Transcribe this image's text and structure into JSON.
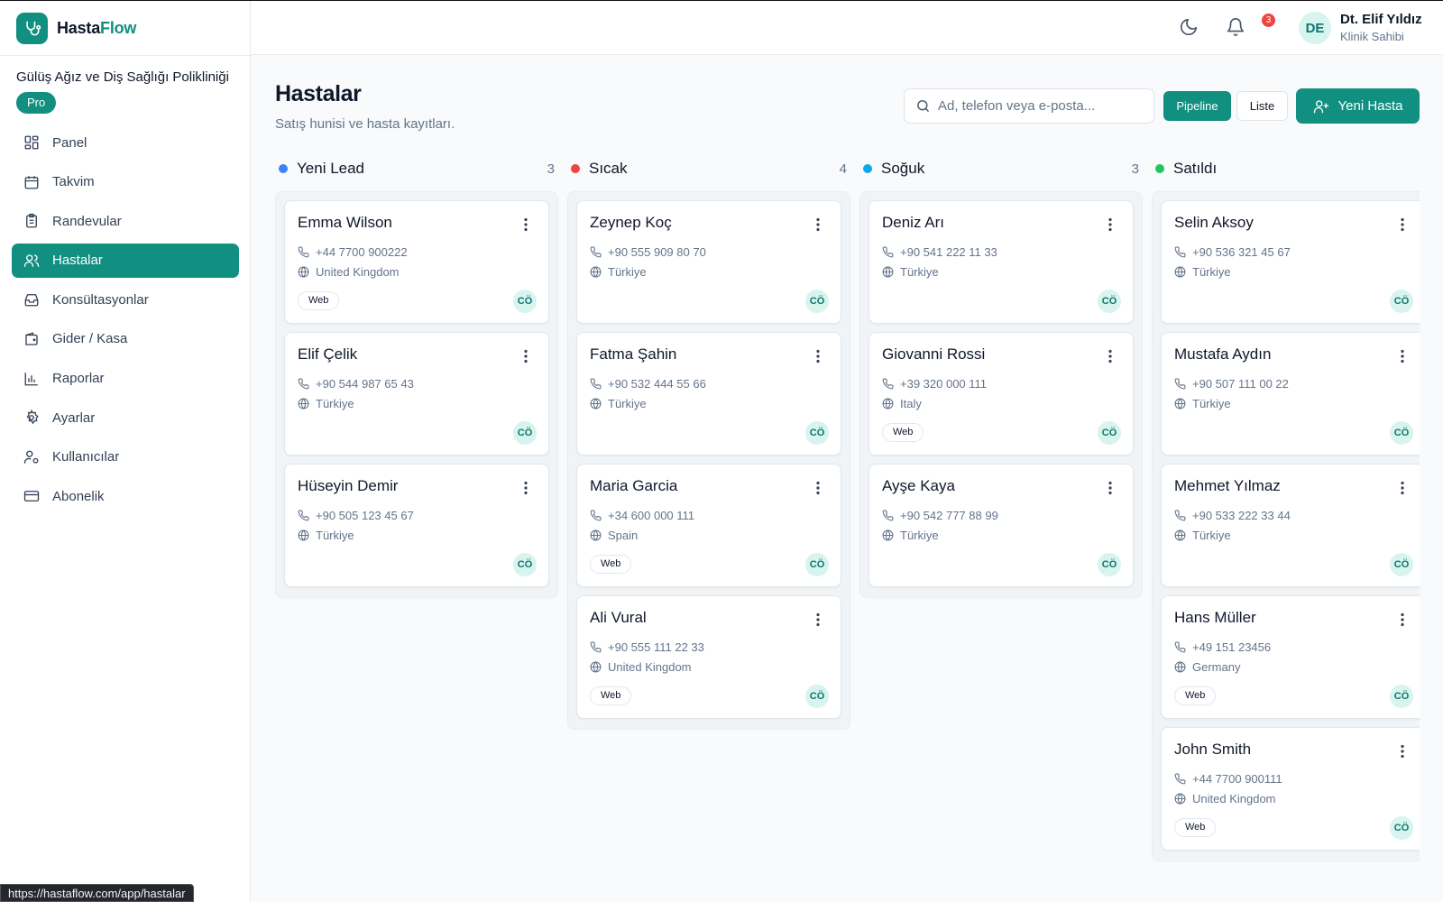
{
  "app": {
    "name_part1": "Hasta",
    "name_part2": "Flow"
  },
  "sidebar": {
    "clinic_name": "Gülüş Ağız ve Diş Sağlığı Polikliniği",
    "plan": "Pro",
    "items": [
      {
        "label": "Panel",
        "icon": "dashboard-icon"
      },
      {
        "label": "Takvim",
        "icon": "calendar-icon"
      },
      {
        "label": "Randevular",
        "icon": "clipboard-icon"
      },
      {
        "label": "Hastalar",
        "icon": "users-icon",
        "active": true
      },
      {
        "label": "Konsültasyonlar",
        "icon": "inbox-icon"
      },
      {
        "label": "Gider / Kasa",
        "icon": "wallet-icon"
      },
      {
        "label": "Raporlar",
        "icon": "bar-chart-icon"
      },
      {
        "label": "Ayarlar",
        "icon": "gear-icon"
      },
      {
        "label": "Kullanıcılar",
        "icon": "user-gear-icon"
      },
      {
        "label": "Abonelik",
        "icon": "credit-card-icon"
      }
    ]
  },
  "topbar": {
    "notification_count": "3",
    "user_initials": "DE",
    "user_name": "Dt. Elif Yıldız",
    "user_role": "Klinik Sahibi"
  },
  "page": {
    "title": "Hastalar",
    "subtitle": "Satış hunisi ve hasta kayıtları.",
    "search_placeholder": "Ad, telefon veya e-posta...",
    "pipeline_label": "Pipeline",
    "list_label": "Liste",
    "new_patient_label": "Yeni Hasta"
  },
  "status_url": "https://hastaflow.com/app/hastalar",
  "columns": [
    {
      "title": "Yeni Lead",
      "count": "3",
      "color": "#3b82f6",
      "cards": [
        {
          "name": "Emma Wilson",
          "phone": "+44 7700 900222",
          "country": "United Kingdom",
          "source": "Web",
          "assignee": "CÖ"
        },
        {
          "name": "Elif Çelik",
          "phone": "+90 544 987 65 43",
          "country": "Türkiye",
          "source": "",
          "assignee": "CÖ"
        },
        {
          "name": "Hüseyin Demir",
          "phone": "+90 505 123 45 67",
          "country": "Türkiye",
          "source": "",
          "assignee": "CÖ"
        }
      ]
    },
    {
      "title": "Sıcak",
      "count": "4",
      "color": "#ef4444",
      "cards": [
        {
          "name": "Zeynep Koç",
          "phone": "+90 555 909 80 70",
          "country": "Türkiye",
          "source": "",
          "assignee": "CÖ"
        },
        {
          "name": "Fatma Şahin",
          "phone": "+90 532 444 55 66",
          "country": "Türkiye",
          "source": "",
          "assignee": "CÖ"
        },
        {
          "name": "Maria Garcia",
          "phone": "+34 600 000 111",
          "country": "Spain",
          "source": "Web",
          "assignee": "CÖ"
        },
        {
          "name": "Ali Vural",
          "phone": "+90 555 111 22 33",
          "country": "United Kingdom",
          "source": "Web",
          "assignee": "CÖ"
        }
      ]
    },
    {
      "title": "Soğuk",
      "count": "3",
      "color": "#0ea5e9",
      "cards": [
        {
          "name": "Deniz Arı",
          "phone": "+90 541 222 11 33",
          "country": "Türkiye",
          "source": "",
          "assignee": "CÖ"
        },
        {
          "name": "Giovanni Rossi",
          "phone": "+39 320 000 111",
          "country": "Italy",
          "source": "Web",
          "assignee": "CÖ"
        },
        {
          "name": "Ayşe Kaya",
          "phone": "+90 542 777 88 99",
          "country": "Türkiye",
          "source": "",
          "assignee": "CÖ"
        }
      ]
    },
    {
      "title": "Satıldı",
      "count": "",
      "color": "#22c55e",
      "cards": [
        {
          "name": "Selin Aksoy",
          "phone": "+90 536 321 45 67",
          "country": "Türkiye",
          "source": "",
          "assignee": "CÖ"
        },
        {
          "name": "Mustafa Aydın",
          "phone": "+90 507 111 00 22",
          "country": "Türkiye",
          "source": "",
          "assignee": "CÖ"
        },
        {
          "name": "Mehmet Yılmaz",
          "phone": "+90 533 222 33 44",
          "country": "Türkiye",
          "source": "",
          "assignee": "CÖ"
        },
        {
          "name": "Hans Müller",
          "phone": "+49 151 23456",
          "country": "Germany",
          "source": "Web",
          "assignee": "CÖ"
        },
        {
          "name": "John Smith",
          "phone": "+44 7700 900111",
          "country": "United Kingdom",
          "source": "Web",
          "assignee": "CÖ"
        }
      ]
    }
  ]
}
